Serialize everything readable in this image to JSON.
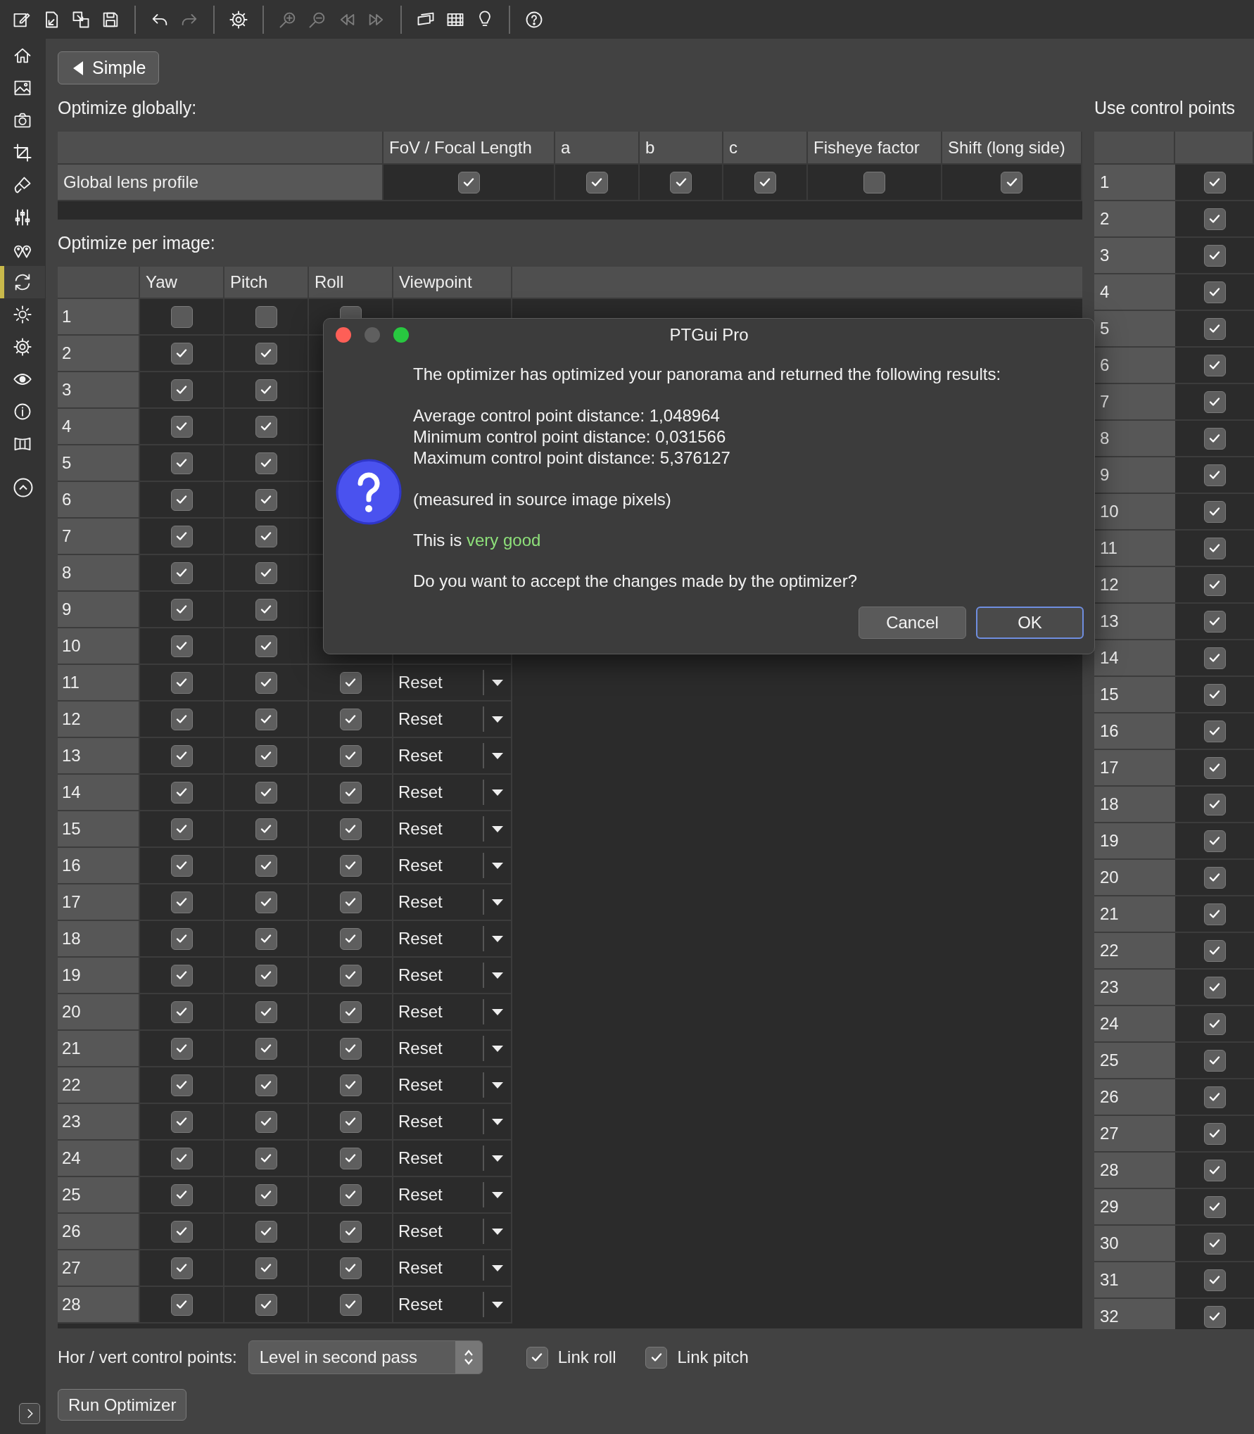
{
  "toolbar": {
    "groups": [
      {
        "items": [
          {
            "kind": "edit",
            "disabled": false
          },
          {
            "kind": "export",
            "disabled": false
          },
          {
            "kind": "copy",
            "disabled": false
          },
          {
            "kind": "save",
            "disabled": false
          }
        ]
      },
      {
        "items": [
          {
            "kind": "undo",
            "disabled": false
          },
          {
            "kind": "redo",
            "disabled": true
          }
        ]
      },
      {
        "items": [
          {
            "kind": "settings",
            "disabled": false
          }
        ]
      },
      {
        "items": [
          {
            "kind": "zoom-in",
            "disabled": true
          },
          {
            "kind": "zoom-out",
            "disabled": true
          },
          {
            "kind": "rewind",
            "disabled": true
          },
          {
            "kind": "forward",
            "disabled": true
          }
        ]
      },
      {
        "items": [
          {
            "kind": "frames",
            "disabled": false
          },
          {
            "kind": "grid",
            "disabled": false
          },
          {
            "kind": "bulb",
            "disabled": false
          }
        ]
      },
      {
        "items": [
          {
            "kind": "help",
            "disabled": false
          }
        ]
      }
    ]
  },
  "sidebar": {
    "items": [
      {
        "kind": "home",
        "selected": false
      },
      {
        "kind": "image",
        "selected": false
      },
      {
        "kind": "camera",
        "selected": false
      },
      {
        "kind": "crop",
        "selected": false
      },
      {
        "kind": "brush",
        "selected": false
      },
      {
        "kind": "sliders",
        "selected": false
      },
      {
        "kind": "pins",
        "selected": false
      },
      {
        "kind": "refresh",
        "selected": true
      },
      {
        "kind": "sun",
        "selected": false
      },
      {
        "kind": "settings",
        "selected": false
      },
      {
        "kind": "eye",
        "selected": false
      },
      {
        "kind": "info",
        "selected": false
      },
      {
        "kind": "panorama",
        "selected": false
      }
    ]
  },
  "back_button": {
    "label": "Simple"
  },
  "global": {
    "title": "Optimize globally:",
    "columns": [
      "FoV / Focal Length",
      "a",
      "b",
      "c",
      "Fisheye factor",
      "Shift (long side)"
    ],
    "rows": [
      {
        "label": "Global lens profile",
        "checks": [
          true,
          true,
          true,
          true,
          false,
          true
        ]
      }
    ]
  },
  "per_image": {
    "title": "Optimize per image:",
    "columns": [
      "Yaw",
      "Pitch",
      "Roll",
      "Viewpoint"
    ],
    "rows": [
      {
        "label": "1",
        "yaw": false,
        "pitch": false,
        "roll": false
      },
      {
        "label": "2",
        "yaw": true,
        "pitch": true
      },
      {
        "label": "3",
        "yaw": true,
        "pitch": true
      },
      {
        "label": "4",
        "yaw": true,
        "pitch": true
      },
      {
        "label": "5",
        "yaw": true,
        "pitch": true
      },
      {
        "label": "6",
        "yaw": true,
        "pitch": true
      },
      {
        "label": "7",
        "yaw": true,
        "pitch": true
      },
      {
        "label": "8",
        "yaw": true,
        "pitch": true
      },
      {
        "label": "9",
        "yaw": true,
        "pitch": true
      },
      {
        "label": "10",
        "yaw": true,
        "pitch": true
      },
      {
        "label": "11",
        "yaw": true,
        "pitch": true,
        "roll": true,
        "viewpoint": "Reset"
      },
      {
        "label": "12",
        "yaw": true,
        "pitch": true,
        "roll": true,
        "viewpoint": "Reset"
      },
      {
        "label": "13",
        "yaw": true,
        "pitch": true,
        "roll": true,
        "viewpoint": "Reset"
      },
      {
        "label": "14",
        "yaw": true,
        "pitch": true,
        "roll": true,
        "viewpoint": "Reset"
      },
      {
        "label": "15",
        "yaw": true,
        "pitch": true,
        "roll": true,
        "viewpoint": "Reset"
      },
      {
        "label": "16",
        "yaw": true,
        "pitch": true,
        "roll": true,
        "viewpoint": "Reset"
      },
      {
        "label": "17",
        "yaw": true,
        "pitch": true,
        "roll": true,
        "viewpoint": "Reset"
      },
      {
        "label": "18",
        "yaw": true,
        "pitch": true,
        "roll": true,
        "viewpoint": "Reset"
      },
      {
        "label": "19",
        "yaw": true,
        "pitch": true,
        "roll": true,
        "viewpoint": "Reset"
      },
      {
        "label": "20",
        "yaw": true,
        "pitch": true,
        "roll": true,
        "viewpoint": "Reset"
      },
      {
        "label": "21",
        "yaw": true,
        "pitch": true,
        "roll": true,
        "viewpoint": "Reset"
      },
      {
        "label": "22",
        "yaw": true,
        "pitch": true,
        "roll": true,
        "viewpoint": "Reset"
      },
      {
        "label": "23",
        "yaw": true,
        "pitch": true,
        "roll": true,
        "viewpoint": "Reset"
      },
      {
        "label": "24",
        "yaw": true,
        "pitch": true,
        "roll": true,
        "viewpoint": "Reset"
      },
      {
        "label": "25",
        "yaw": true,
        "pitch": true,
        "roll": true,
        "viewpoint": "Reset"
      },
      {
        "label": "26",
        "yaw": true,
        "pitch": true,
        "roll": true,
        "viewpoint": "Reset"
      },
      {
        "label": "27",
        "yaw": true,
        "pitch": true,
        "roll": true,
        "viewpoint": "Reset"
      },
      {
        "label": "28",
        "yaw": true,
        "pitch": true,
        "roll": true,
        "viewpoint": "Reset"
      }
    ]
  },
  "control_points": {
    "title": "Use control points",
    "rows": [
      {
        "label": "1",
        "checked": true
      },
      {
        "label": "2",
        "checked": true
      },
      {
        "label": "3",
        "checked": true
      },
      {
        "label": "4",
        "checked": true
      },
      {
        "label": "5",
        "checked": true
      },
      {
        "label": "6",
        "checked": true
      },
      {
        "label": "7",
        "checked": true
      },
      {
        "label": "8",
        "checked": true
      },
      {
        "label": "9",
        "checked": true
      },
      {
        "label": "10",
        "checked": true
      },
      {
        "label": "11",
        "checked": true
      },
      {
        "label": "12",
        "checked": true
      },
      {
        "label": "13",
        "checked": true
      },
      {
        "label": "14",
        "checked": true
      },
      {
        "label": "15",
        "checked": true
      },
      {
        "label": "16",
        "checked": true
      },
      {
        "label": "17",
        "checked": true
      },
      {
        "label": "18",
        "checked": true
      },
      {
        "label": "19",
        "checked": true
      },
      {
        "label": "20",
        "checked": true
      },
      {
        "label": "21",
        "checked": true
      },
      {
        "label": "22",
        "checked": true
      },
      {
        "label": "23",
        "checked": true
      },
      {
        "label": "24",
        "checked": true
      },
      {
        "label": "25",
        "checked": true
      },
      {
        "label": "26",
        "checked": true
      },
      {
        "label": "27",
        "checked": true
      },
      {
        "label": "28",
        "checked": true
      },
      {
        "label": "29",
        "checked": true
      },
      {
        "label": "30",
        "checked": true
      },
      {
        "label": "31",
        "checked": true
      },
      {
        "label": "32",
        "checked": true
      }
    ]
  },
  "options": {
    "label": "Hor / vert control points:",
    "select": {
      "value": "Level in second pass"
    },
    "checks": [
      {
        "label": "Link roll",
        "checked": true
      },
      {
        "label": "Link pitch",
        "checked": true
      }
    ],
    "run_button": "Run Optimizer"
  },
  "dialog": {
    "title": "PTGui Pro",
    "message": "The optimizer has optimized your panorama and returned the following results:",
    "results": [
      "Average control point distance: 1,048964",
      "Minimum control point distance: 0,031566",
      "Maximum control point distance: 5,376127"
    ],
    "note": "(measured in source image pixels)",
    "verdict": {
      "text": "This is ",
      "highlight": "very good"
    },
    "question": "Do you want to accept the changes made by the optimizer?",
    "buttons": [
      {
        "label": "Cancel",
        "default": false
      },
      {
        "label": "OK",
        "default": true
      }
    ]
  }
}
